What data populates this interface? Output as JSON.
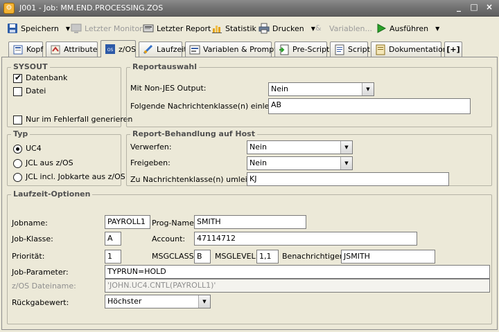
{
  "window": {
    "title": "J001 - Job: MM.END.PROCESSING.ZOS",
    "icon": "gear-icon"
  },
  "toolbar": {
    "save": "Speichern",
    "last_monitor": "Letzter Monitor",
    "last_report": "Letzter Report",
    "statistics": "Statistik",
    "print": "Drucken",
    "variables": "Variablen...",
    "execute": "Ausführen"
  },
  "tabs": [
    {
      "label": "Kopf"
    },
    {
      "label": "Attribute"
    },
    {
      "label": "z/OS"
    },
    {
      "label": "Laufzeit"
    },
    {
      "label": "Variablen & Prompts"
    },
    {
      "label": "Pre-Script"
    },
    {
      "label": "Script"
    },
    {
      "label": "Dokumentation"
    },
    {
      "label": "[+]"
    }
  ],
  "sysout": {
    "title": "SYSOUT",
    "database": {
      "label": "Datenbank",
      "checked": true
    },
    "file": {
      "label": "Datei",
      "checked": false
    },
    "error_only": {
      "label": "Nur im Fehlerfall generieren",
      "checked": false
    }
  },
  "report_selection": {
    "title": "Reportauswahl",
    "non_jes_label": "Mit Non-JES Output:",
    "non_jes_value": "Nein",
    "msg_classes_label": "Folgende Nachrichtenklasse(n) einlesen:",
    "msg_classes_value": "AB"
  },
  "type": {
    "title": "Typ",
    "options": [
      "UC4",
      "JCL aus z/OS",
      "JCL incl. Jobkarte aus z/OS"
    ],
    "selected": 0
  },
  "report_handling": {
    "title": "Report-Behandlung auf Host",
    "discard_label": "Verwerfen:",
    "discard_value": "Nein",
    "release_label": "Freigeben:",
    "release_value": "Nein",
    "redirect_label": "Zu Nachrichtenklasse(n) umleiten:",
    "redirect_value": "KJ"
  },
  "runtime": {
    "title": "Laufzeit-Optionen",
    "jobname_label": "Jobname:",
    "jobname": "PAYROLL1",
    "progname_label": "Prog-Name:",
    "progname": "SMITH",
    "jobclass_label": "Job-Klasse:",
    "jobclass": "A",
    "account_label": "Account:",
    "account": "47114712",
    "priority_label": "Priorität:",
    "priority": "1",
    "msgclass_label": "MSGCLASS:",
    "msgclass": "B",
    "msglevel_label": "MSGLEVEL:",
    "msglevel": "1,1",
    "notify_label": "Benachrichtigen:",
    "notify": "JSMITH",
    "jobparam_label": "Job-Parameter:",
    "jobparam": "TYPRUN=HOLD",
    "zosfile_label": "z/OS Dateiname:",
    "zosfile": "'JOHN.UC4.CNTL(PAYROLL1)'",
    "returncode_label": "Rückgabewert:",
    "returncode": "Höchster"
  }
}
